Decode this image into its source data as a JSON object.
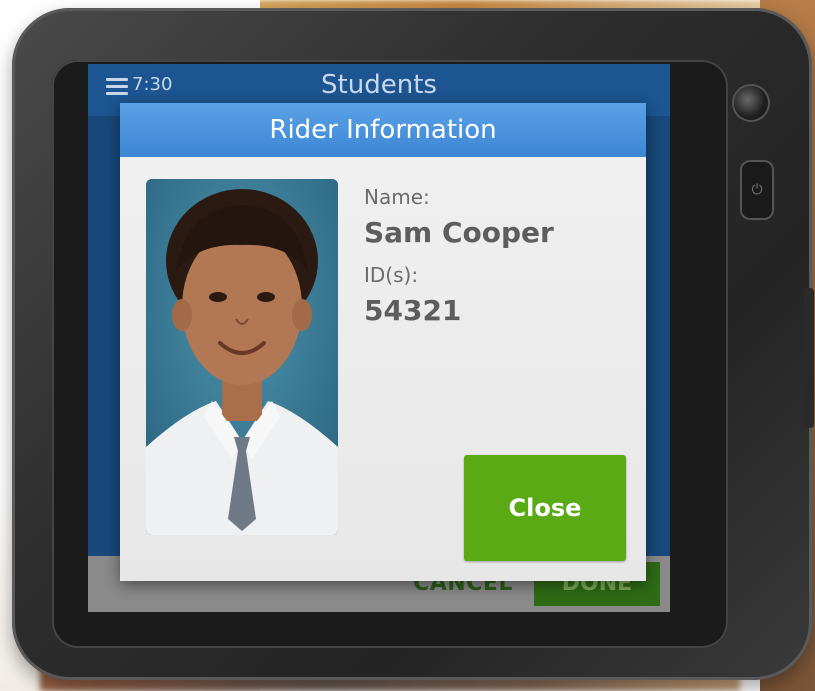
{
  "app": {
    "time": "7:30",
    "title": "Students",
    "cancel_label": "CANCEL",
    "done_label": "DONE"
  },
  "modal": {
    "title": "Rider Information",
    "name_label": "Name:",
    "name_value": "Sam Cooper",
    "id_label": "ID(s):",
    "id_value": "54321",
    "close_label": "Close"
  },
  "colors": {
    "modal_header": "#4a93dd",
    "close_button": "#5aaa16",
    "done_button": "#2f6b16",
    "app_header": "#1c5591"
  },
  "icons": {
    "menu": "menu-icon",
    "power": "power-icon",
    "camera": "camera-icon"
  }
}
